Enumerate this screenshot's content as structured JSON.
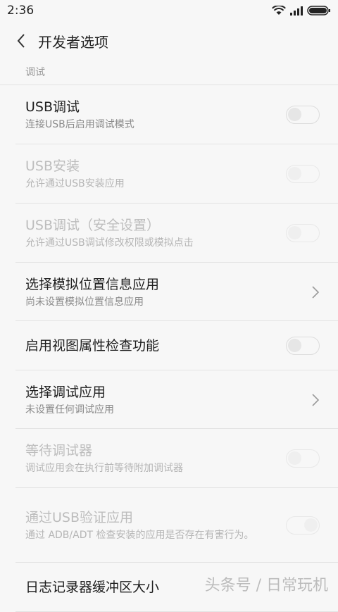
{
  "status_bar": {
    "time": "2:36"
  },
  "header": {
    "title": "开发者选项"
  },
  "section": {
    "label": "调试"
  },
  "items": [
    {
      "title": "USB调试",
      "subtitle": "连接USB后启用调试模式",
      "control": "toggle",
      "state": "off",
      "enabled": true
    },
    {
      "title": "USB安装",
      "subtitle": "允许通过USB安装应用",
      "control": "toggle",
      "state": "off",
      "enabled": false
    },
    {
      "title": "USB调试（安全设置）",
      "subtitle": "允许通过USB调试修改权限或模拟点击",
      "control": "toggle",
      "state": "off",
      "enabled": false
    },
    {
      "title": "选择模拟位置信息应用",
      "subtitle": "尚未设置模拟位置信息应用",
      "control": "chevron",
      "enabled": true
    },
    {
      "title": "启用视图属性检查功能",
      "subtitle": "",
      "control": "toggle",
      "state": "off",
      "enabled": true
    },
    {
      "title": "选择调试应用",
      "subtitle": "未设置任何调试应用",
      "control": "chevron",
      "enabled": true
    },
    {
      "title": "等待调试器",
      "subtitle": "调试应用会在执行前等待附加调试器",
      "control": "toggle",
      "state": "off",
      "enabled": false
    },
    {
      "title": "通过USB验证应用",
      "subtitle": "通过 ADB/ADT 检查安装的应用是否存在有害行为。",
      "control": "toggle",
      "state": "on",
      "enabled": false
    },
    {
      "title": "日志记录器缓冲区大小",
      "subtitle": "",
      "control": "none",
      "enabled": true
    }
  ],
  "watermark": "头条号 / 日常玩机",
  "colors": {
    "toggle_on": "#7ec8f5",
    "background": "#f7f7f7"
  }
}
